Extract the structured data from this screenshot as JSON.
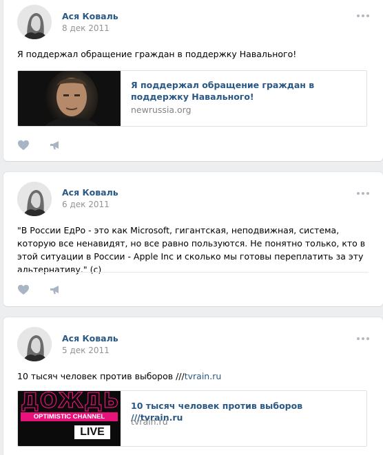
{
  "posts": [
    {
      "author": "Ася Коваль",
      "date": "8 дек 2011",
      "text": "Я поддержал обращение граждан в поддержку Навального!",
      "card": {
        "title": "Я поддержал обращение граждан в поддержку Навального!",
        "domain": "newrussia.org"
      }
    },
    {
      "author": "Ася Коваль",
      "date": "6 дек 2011",
      "text": "\"В России ЕдРо - это как Microsoft, гигантская, неподвижная, система, которую все ненавидят, но все равно пользуются. Не понятно только, кто в этой ситуации в России - Apple Inc и сколько мы готовы переплатить за эту альтернативу.\" (c)"
    },
    {
      "author": "Ася Коваль",
      "date": "5 дек 2011",
      "text_prefix": "10 тысяч человек против выборов ///",
      "text_link": "tvrain.ru",
      "card": {
        "title": "10 тысяч человек против выборов ///tvrain.ru",
        "domain": "tvrain.ru",
        "logo_text": "ДОЖДЬ",
        "logo_sub": "OPTIMISTIC CHANNEL",
        "logo_live": "LIVE"
      }
    }
  ],
  "icons": {
    "like": "heart-icon",
    "share": "megaphone-icon",
    "menu": "more-dots-icon"
  },
  "colors": {
    "link": "#2a5885",
    "icon": "#a8b5c4",
    "background": "#edeef0"
  }
}
